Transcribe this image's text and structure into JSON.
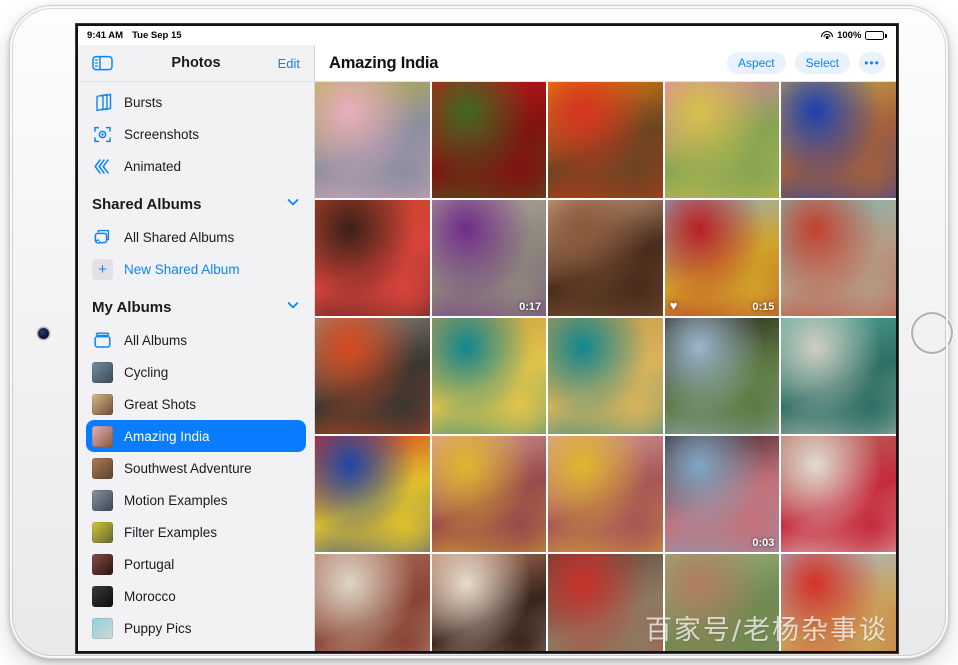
{
  "status_bar": {
    "time": "9:41 AM",
    "date": "Tue Sep 15",
    "battery_percent": "100%"
  },
  "sidebar": {
    "toggle_icon": "sidebar-toggle-icon",
    "title": "Photos",
    "edit_label": "Edit",
    "items": [
      {
        "label": "Bursts",
        "icon": "bursts-icon",
        "kind": "glyph"
      },
      {
        "label": "Screenshots",
        "icon": "screenshots-icon",
        "kind": "glyph"
      },
      {
        "label": "Animated",
        "icon": "animated-icon",
        "kind": "glyph"
      }
    ],
    "groups": [
      {
        "title": "Shared Albums",
        "chevron": "chevron-down-icon",
        "items": [
          {
            "label": "All Shared Albums",
            "icon": "all-shared-albums-icon",
            "kind": "glyph"
          },
          {
            "label": "New Shared Album",
            "icon": "plus-icon",
            "kind": "action"
          }
        ]
      },
      {
        "title": "My Albums",
        "chevron": "chevron-down-icon",
        "items": [
          {
            "label": "All Albums",
            "icon": "all-albums-icon",
            "kind": "glyph"
          },
          {
            "label": "Cycling",
            "kind": "thumb",
            "thumb_colors": [
              "#6e8fa6",
              "#3d4a52"
            ]
          },
          {
            "label": "Great Shots",
            "kind": "thumb",
            "thumb_colors": [
              "#d9bb7e",
              "#6d4a3a"
            ]
          },
          {
            "label": "Amazing India",
            "kind": "thumb",
            "thumb_colors": [
              "#e0b2bd",
              "#8a5a3a"
            ],
            "selected": true
          },
          {
            "label": "Southwest Adventure",
            "kind": "thumb",
            "thumb_colors": [
              "#b07a52",
              "#5a4232"
            ]
          },
          {
            "label": "Motion Examples",
            "kind": "thumb",
            "thumb_colors": [
              "#8a93a0",
              "#3b4452"
            ]
          },
          {
            "label": "Filter Examples",
            "kind": "thumb",
            "thumb_colors": [
              "#d8c23f",
              "#5d6b2c"
            ]
          },
          {
            "label": "Portugal",
            "kind": "thumb",
            "thumb_colors": [
              "#8a4a47",
              "#2b1412"
            ]
          },
          {
            "label": "Morocco",
            "kind": "thumb",
            "thumb_colors": [
              "#3a3a3c",
              "#0c0c0e"
            ]
          },
          {
            "label": "Puppy Pics",
            "kind": "thumb",
            "thumb_colors": [
              "#8fd0e0",
              "#cfd8d2"
            ]
          }
        ]
      }
    ],
    "selected_item": "Amazing India"
  },
  "content": {
    "title": "Amazing India",
    "actions": [
      {
        "label": "Aspect",
        "name": "aspect-button"
      },
      {
        "label": "Select",
        "name": "select-button"
      },
      {
        "label": "•••",
        "name": "more-options-button"
      }
    ],
    "photos": [
      {
        "id": 1,
        "desc": "yellow-door-pink-wall",
        "c1": "#b9b33f",
        "c2": "#e9aebe",
        "c3": "#8d8ea0",
        "type": "photo"
      },
      {
        "id": 2,
        "desc": "red-poppy-flower",
        "c1": "#cf1718",
        "c2": "#3f6a22",
        "c3": "#7f1410",
        "type": "photo"
      },
      {
        "id": 3,
        "desc": "oranges-in-red-crate",
        "c1": "#f08a12",
        "c2": "#d8331f",
        "c3": "#6d4521",
        "type": "photo"
      },
      {
        "id": 4,
        "desc": "pink-snapdragon-flowers",
        "c1": "#e87fb2",
        "c2": "#d7c14a",
        "c3": "#86a553",
        "type": "photo"
      },
      {
        "id": 5,
        "desc": "man-blue-suit-ochre-wall",
        "c1": "#cfa94a",
        "c2": "#1c3fb0",
        "c3": "#a3603c",
        "type": "photo"
      },
      {
        "id": 6,
        "desc": "woman-red-sari-portrait",
        "c1": "#c0472a",
        "c2": "#3a2018",
        "c3": "#d8433c",
        "type": "photo"
      },
      {
        "id": 7,
        "desc": "aerial-purple-powder",
        "c1": "#b4a89a",
        "c2": "#6f2b8a",
        "c3": "#8e867c",
        "type": "video",
        "duration": "0:17"
      },
      {
        "id": 8,
        "desc": "two-faces-close-up",
        "c1": "#d6a98a",
        "c2": "#8a5a3c",
        "c3": "#4a2c1c",
        "type": "photo"
      },
      {
        "id": 9,
        "desc": "red-yellow-festival-flags",
        "c1": "#86b7dc",
        "c2": "#b81f24",
        "c3": "#d1a229",
        "type": "video",
        "duration": "0:15",
        "favorite": true
      },
      {
        "id": 10,
        "desc": "woman-striped-dress-wall",
        "c1": "#7cc3bb",
        "c2": "#c3402e",
        "c3": "#b69a85",
        "type": "photo"
      },
      {
        "id": 11,
        "desc": "man-orange-shirt-door",
        "c1": "#9a9086",
        "c2": "#d84a1d",
        "c3": "#3b3631",
        "type": "photo"
      },
      {
        "id": 12,
        "desc": "person-yellow-headwrap",
        "c1": "#c79a45",
        "c2": "#12868e",
        "c3": "#e0c34a",
        "type": "photo"
      },
      {
        "id": 13,
        "desc": "person-hand-over-mouth",
        "c1": "#c79a45",
        "c2": "#12868e",
        "c3": "#d9b35b",
        "type": "photo"
      },
      {
        "id": 14,
        "desc": "archway-woman-red-sari",
        "c1": "#231a15",
        "c2": "#9cb6cd",
        "c3": "#5d7a42",
        "type": "photo"
      },
      {
        "id": 15,
        "desc": "turquoise-painted-door",
        "c1": "#53a79b",
        "c2": "#cfcfc2",
        "c3": "#2f6f66",
        "type": "photo"
      },
      {
        "id": 16,
        "desc": "red-blue-dyed-fabrics",
        "c1": "#d8261d",
        "c2": "#1f46a5",
        "c3": "#e0c02a",
        "type": "photo"
      },
      {
        "id": 17,
        "desc": "person-yellow-shirt-cloth",
        "c1": "#d8a0a4",
        "c2": "#e0b62c",
        "c3": "#9a4b4b",
        "type": "photo"
      },
      {
        "id": 18,
        "desc": "person-pink-cloth-field",
        "c1": "#d8a0a4",
        "c2": "#e0b62c",
        "c3": "#a85656",
        "type": "photo"
      },
      {
        "id": 19,
        "desc": "silhouette-arch-pink-wall",
        "c1": "#2b1a1e",
        "c2": "#7fa7c4",
        "c3": "#c3717a",
        "type": "video",
        "duration": "0:03"
      },
      {
        "id": 20,
        "desc": "humayun-tomb-red-sari",
        "c1": "#b0705a",
        "c2": "#e0dcd2",
        "c3": "#c62b3e",
        "type": "photo"
      },
      {
        "id": 21,
        "desc": "mughal-facade-arches",
        "c1": "#b0705a",
        "c2": "#ddd6c8",
        "c3": "#8a4434",
        "type": "photo"
      },
      {
        "id": 22,
        "desc": "mughal-gateway-entrance",
        "c1": "#bd7b62",
        "c2": "#e6dccd",
        "c3": "#3a241c",
        "type": "photo"
      },
      {
        "id": 23,
        "desc": "stairway-woman-red-dress",
        "c1": "#5a4438",
        "c2": "#c9302b",
        "c3": "#8d7a62",
        "type": "photo"
      },
      {
        "id": 24,
        "desc": "garden-wall-pathway",
        "c1": "#9fb37f",
        "c2": "#b07d5e",
        "c3": "#6f8a52",
        "type": "photo"
      },
      {
        "id": 25,
        "desc": "dancer-red-veil-sky",
        "c1": "#9fc0dc",
        "c2": "#d43026",
        "c3": "#c9a25a",
        "type": "photo"
      }
    ]
  },
  "watermark": "百家号/老杨杂事谈"
}
